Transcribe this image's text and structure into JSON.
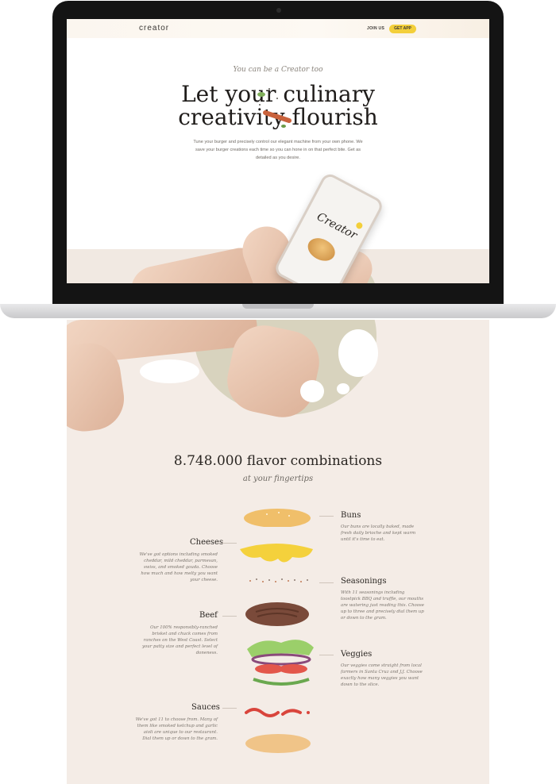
{
  "nav": {
    "logo": "creator",
    "join_label": "JOIN US",
    "get_app_label": "GET APP"
  },
  "hero": {
    "eyebrow": "You can be a Creator too",
    "headline_line1": "Let your culinary",
    "headline_line2": "creativity flourish",
    "lead": "Tune your burger and precisely control our elegant machine from your own phone. We save your burger creations each time so you can hone in on that perfect bite. Get as detailed as you desire."
  },
  "phone": {
    "app_title": "Creator"
  },
  "combos": {
    "title": "8.748.000 flavor combinations",
    "subtitle": "at your fingertips"
  },
  "ingredients": {
    "buns": {
      "title": "Buns",
      "desc": "Our buns are locally baked, made fresh daily brioche and kept warm until it's time to eat."
    },
    "cheeses": {
      "title": "Cheeses",
      "desc": "We've got options including smoked cheddar, mild cheddar, parmesan, swiss, and smoked gouda. Choose how much and how melty you want your cheese."
    },
    "seasonings": {
      "title": "Seasonings",
      "desc": "With 11 seasonings including toostpick BBQ and truffle, our mouths are watering just reading this. Choose up to three and precisely dial them up or down to the gram."
    },
    "beef": {
      "title": "Beef",
      "desc": "Our 100% responsibly-ranched brisket and chuck comes from ranches on the West Coast. Select your patty size and perfect level of doneness."
    },
    "veggies": {
      "title": "Veggies",
      "desc": "Our veggies come straight from local farmers in Santa Cruz and J.J. Choose exactly how many veggies you want down to the slice."
    },
    "sauces": {
      "title": "Sauces",
      "desc": "We've got 11 to choose from. Many of them like smoked ketchup and garlic aioli are unique to our restaurant. Dial them up or down to the gram."
    }
  },
  "colors": {
    "accent": "#f3cf3a",
    "page_bg": "#f4ece6",
    "text": "#2a2622"
  }
}
